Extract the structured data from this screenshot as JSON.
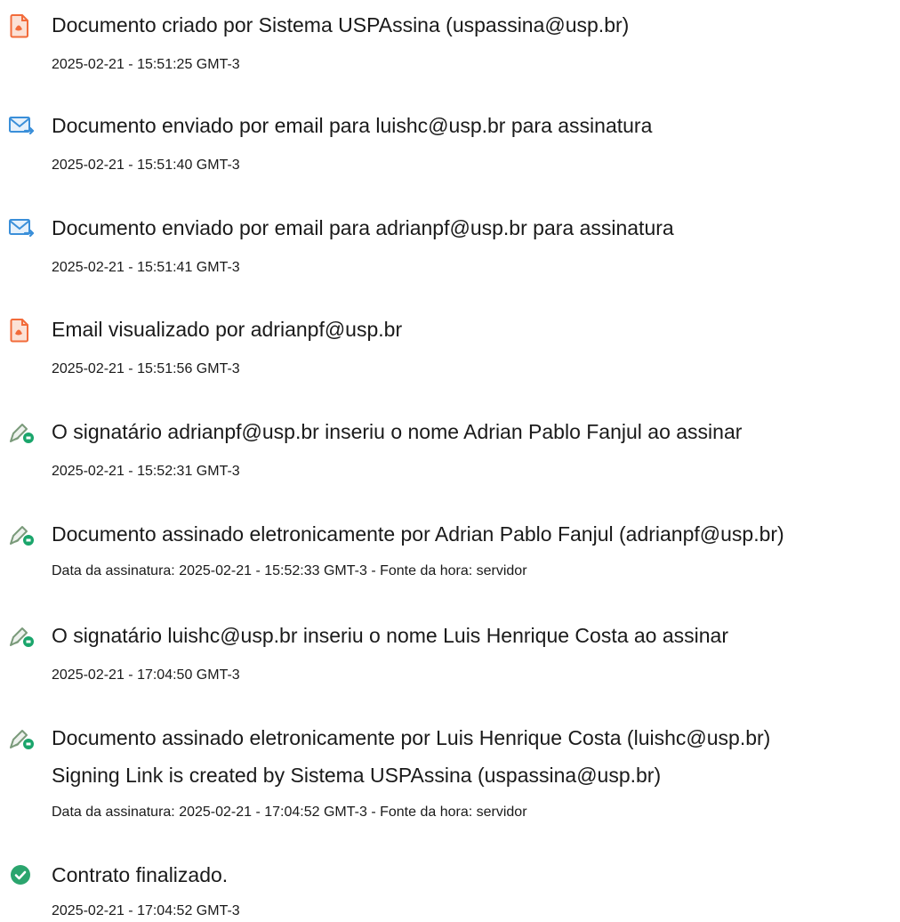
{
  "events": [
    {
      "icon": "pdf-document-icon",
      "title": "Documento criado por Sistema USPAssina (uspassina@usp.br)",
      "meta": "2025-02-21 - 15:51:25 GMT-3"
    },
    {
      "icon": "email-forward-icon",
      "title": "Documento enviado por email para luishc@usp.br para assinatura",
      "meta": "2025-02-21 - 15:51:40 GMT-3"
    },
    {
      "icon": "email-forward-icon",
      "title": "Documento enviado por email para adrianpf@usp.br para assinatura",
      "meta": "2025-02-21 - 15:51:41 GMT-3"
    },
    {
      "icon": "pdf-document-icon",
      "title": "Email visualizado por adrianpf@usp.br",
      "meta": "2025-02-21 - 15:51:56 GMT-3"
    },
    {
      "icon": "signature-pen-icon",
      "title": "O signatário adrianpf@usp.br inseriu o nome Adrian Pablo Fanjul ao assinar",
      "meta": "2025-02-21 - 15:52:31 GMT-3"
    },
    {
      "icon": "signature-pen-icon",
      "title": "Documento assinado eletronicamente por Adrian Pablo Fanjul (adrianpf@usp.br)",
      "meta": "Data da assinatura: 2025-02-21 - 15:52:33 GMT-3 - Fonte da hora: servidor"
    },
    {
      "icon": "signature-pen-icon",
      "title": "O signatário luishc@usp.br inseriu o nome Luis Henrique Costa ao assinar",
      "meta": "2025-02-21 - 17:04:50 GMT-3"
    },
    {
      "icon": "signature-pen-icon",
      "title": "Documento assinado eletronicamente por Luis Henrique Costa (luishc@usp.br)",
      "title2": "Signing Link is created by Sistema USPAssina (uspassina@usp.br)",
      "meta": "Data da assinatura: 2025-02-21 - 17:04:52 GMT-3 - Fonte da hora: servidor"
    },
    {
      "icon": "check-circle-icon",
      "title": "Contrato finalizado.",
      "meta": "2025-02-21 - 17:04:52 GMT-3"
    }
  ],
  "colors": {
    "pdf": "#f26b3a",
    "email": "#3a8fd9",
    "sign_green": "#1aa56b",
    "check": "#2ba56e"
  }
}
